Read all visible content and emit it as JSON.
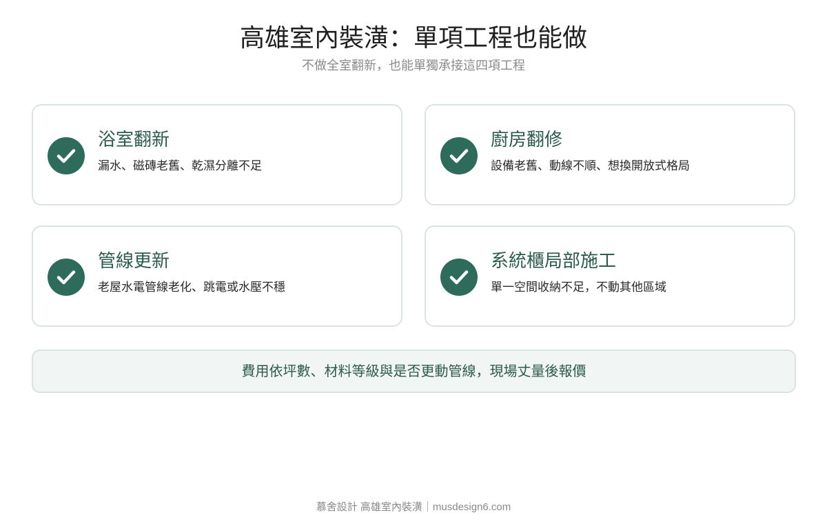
{
  "header": {
    "title": "高雄室內裝潢：單項工程也能做",
    "subtitle": "不做全室翻新，也能單獨承接這四項工程"
  },
  "services": [
    {
      "title": "浴室翻新",
      "description": "漏水、磁磚老舊、乾濕分離不足",
      "icon": "check-circle-icon"
    },
    {
      "title": "廚房翻修",
      "description": "設備老舊、動線不順、想換開放式格局",
      "icon": "check-circle-icon"
    },
    {
      "title": "管線更新",
      "description": "老屋水電管線老化、跳電或水壓不穩",
      "icon": "check-circle-icon"
    },
    {
      "title": "系統櫃局部施工",
      "description": "單一空間收納不足，不動其他區域",
      "icon": "check-circle-icon"
    }
  ],
  "note": {
    "text": "費用依坪數、材料等級與是否更動管線，現場丈量後報價"
  },
  "footer": {
    "text": "慕舍設計 高雄室內裝潢｜musdesign6.com"
  },
  "colors": {
    "accent": "#2f6b5a",
    "title_green": "#2d5a4d",
    "card_border": "#dbe3e1",
    "note_background": "#f1f5f4",
    "muted_text": "#8a8a8a"
  }
}
